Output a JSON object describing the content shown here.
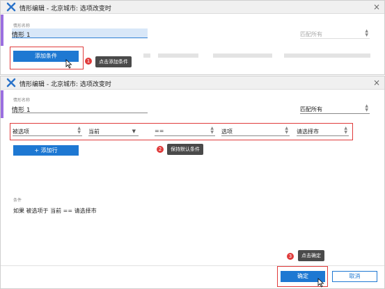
{
  "dialog1": {
    "title": "情形编辑 - 北京城市: 选项改变时",
    "field_label": "情形名称",
    "field_value": "情形 1",
    "match_select": "匹配所有",
    "add_condition_label": "添加条件",
    "marker": "1",
    "tooltip": "点击添加条件"
  },
  "dialog2": {
    "title": "情形编辑 - 北京城市: 选项改变时",
    "field_label": "情形名称",
    "field_value": "情形 1",
    "match_select": "匹配所有",
    "row": {
      "c1": "被选项",
      "c2": "当前",
      "c3": "==",
      "c4": "选项",
      "c5": "请选择市"
    },
    "add_row_label": "+ 添加行",
    "marker2": "2",
    "tooltip2": "保持默认条件",
    "conditions_label": "条件",
    "condition_text": "如果  被选项于 当前 == 请选择市",
    "marker3": "3",
    "tooltip3": "点击确定",
    "ok_label": "确定",
    "cancel_label": "取消"
  },
  "colors": {
    "accent": "#9b6fe0",
    "primary": "#1e78d2",
    "annotation": "#e03b3b"
  }
}
